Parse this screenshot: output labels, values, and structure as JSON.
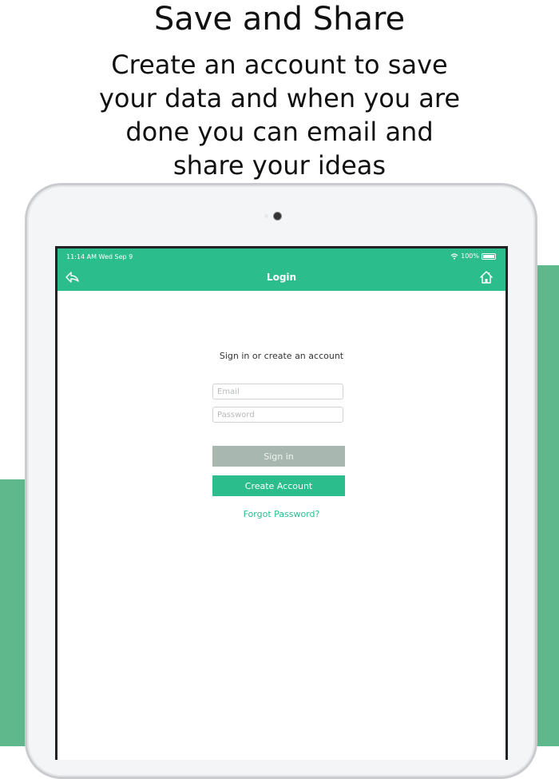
{
  "promo": {
    "headline": "Save and Share",
    "subhead": "Create an account to save your data and when you are done you can email and share your ideas"
  },
  "status_bar": {
    "time": "11:14 AM  Wed Sep 9",
    "battery": "100%"
  },
  "navbar": {
    "title": "Login",
    "back_icon": "reply-arrow-icon",
    "home_icon": "home-icon"
  },
  "login": {
    "prompt": "Sign in or create an account",
    "email_placeholder": "Email",
    "password_placeholder": "Password",
    "sign_in_label": "Sign in",
    "create_account_label": "Create Account",
    "forgot_password_label": "Forgot Password?"
  },
  "colors": {
    "accent": "#2bbd8b",
    "disabled_button": "#a8b8b0",
    "background_shape": "#5fb88c"
  }
}
